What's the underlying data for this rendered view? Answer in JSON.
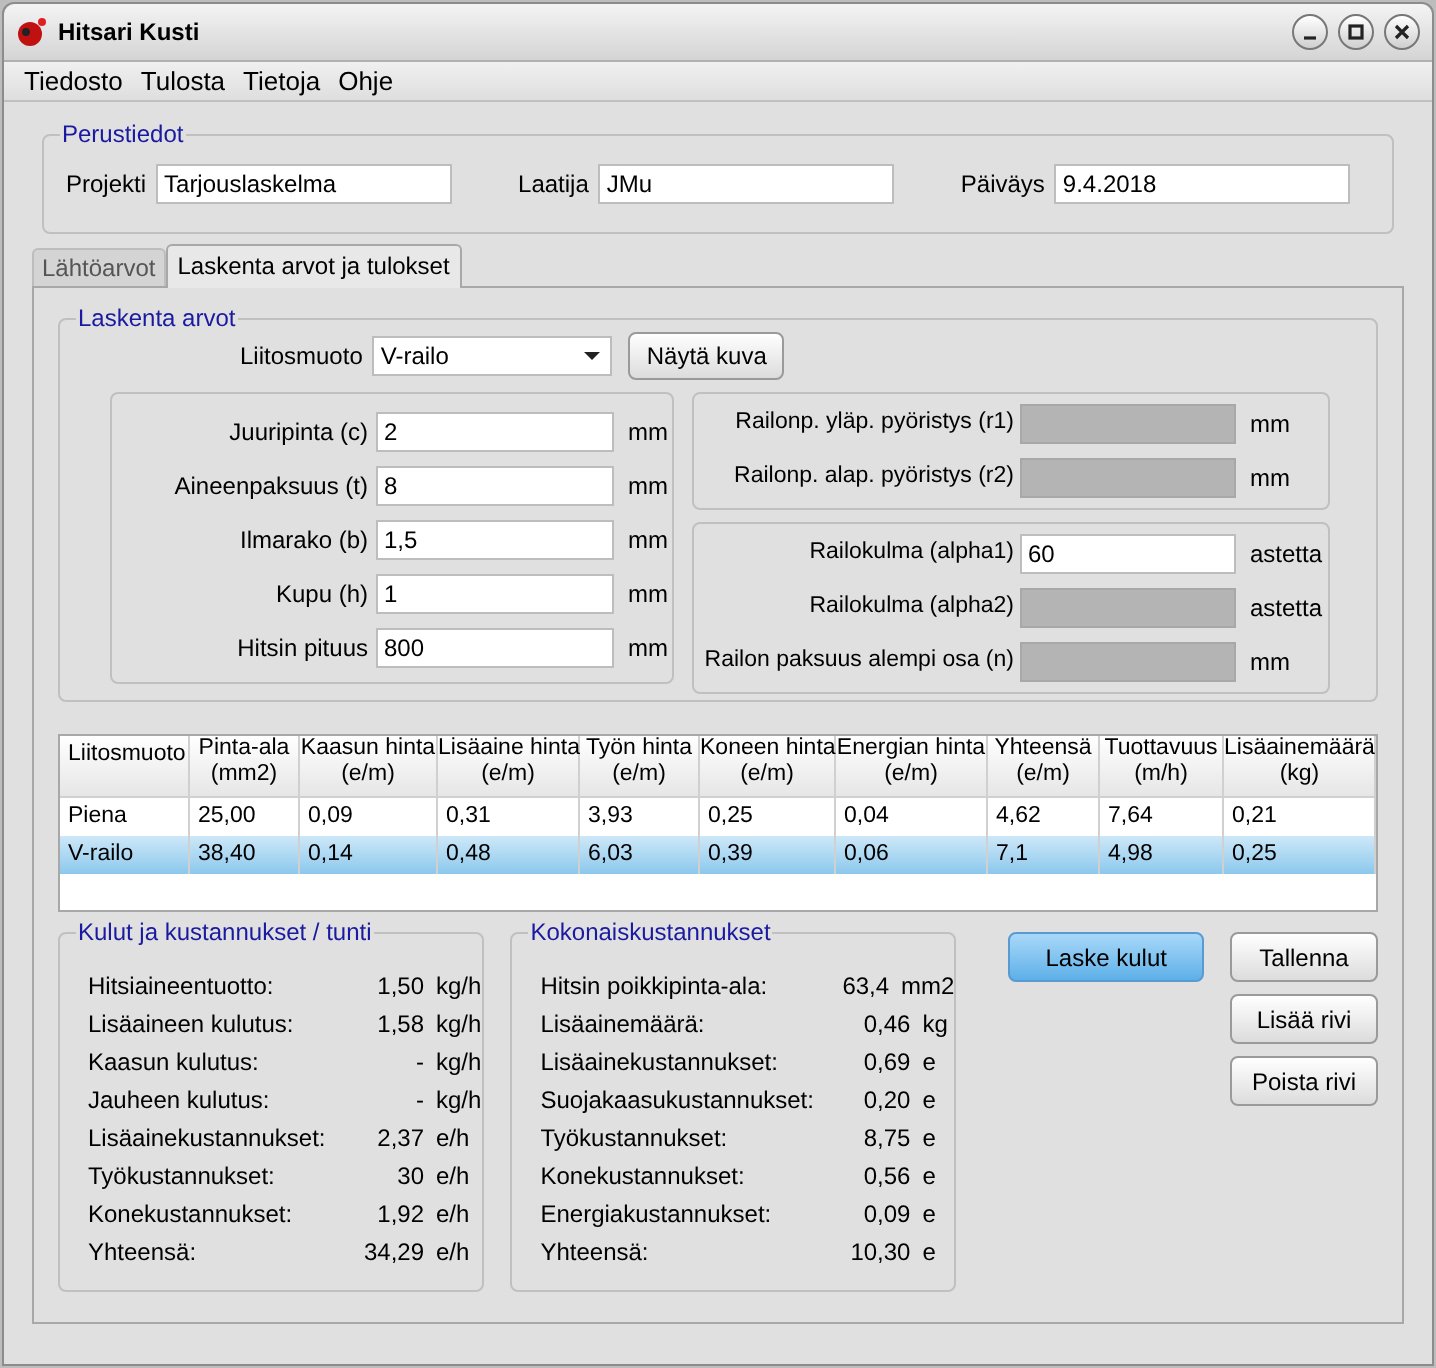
{
  "window": {
    "title": "Hitsari Kusti"
  },
  "menu": [
    "Tiedosto",
    "Tulosta",
    "Tietoja",
    "Ohje"
  ],
  "perustiedot": {
    "title": "Perustiedot",
    "fields": [
      {
        "label": "Projekti",
        "value": "Tarjouslaskelma"
      },
      {
        "label": "Laatija",
        "value": "JMu"
      },
      {
        "label": "Päiväys",
        "value": "9.4.2018"
      }
    ]
  },
  "tabs": [
    {
      "label": "Lähtöarvot",
      "selected": false
    },
    {
      "label": "Laskenta arvot ja tulokset",
      "selected": true
    }
  ],
  "laskenta": {
    "title": "Laskenta arvot",
    "liitosmuoto": {
      "label": "Liitosmuoto",
      "value": "V-railo"
    },
    "show_button": "Näytä kuva",
    "left_fields": [
      {
        "label": "Juuripinta (c)",
        "value": "2",
        "unit": "mm",
        "disabled": false
      },
      {
        "label": "Aineenpaksuus (t)",
        "value": "8",
        "unit": "mm",
        "disabled": false
      },
      {
        "label": "Ilmarako (b)",
        "value": "1,5",
        "unit": "mm",
        "disabled": false
      },
      {
        "label": "Kupu (h)",
        "value": "1",
        "unit": "mm",
        "disabled": false
      },
      {
        "label": "Hitsin pituus",
        "value": "800",
        "unit": "mm",
        "disabled": false
      }
    ],
    "right_groups": [
      [
        {
          "label": "Railonp. yläp. pyöristys (r1)",
          "unit": "mm",
          "disabled": true
        },
        {
          "label": "Railonp. alap. pyöristys (r2)",
          "unit": "mm",
          "disabled": true
        }
      ],
      [
        {
          "label": "Railokulma (alpha1)",
          "value": "60",
          "unit": "astetta",
          "disabled": false
        },
        {
          "label": "Railokulma (alpha2)",
          "unit": "astetta",
          "disabled": true
        },
        {
          "label": "Railon paksuus alempi osa (n)",
          "unit": "mm",
          "disabled": true
        }
      ]
    ]
  },
  "table": {
    "columns": [
      {
        "title": "Liitosmuoto"
      },
      {
        "title": "Pinta-ala",
        "unit": "(mm2)"
      },
      {
        "title": "Kaasun hinta",
        "unit": "(e/m)"
      },
      {
        "title": "Lisäaine hinta",
        "unit": "(e/m)"
      },
      {
        "title": "Työn hinta",
        "unit": "(e/m)"
      },
      {
        "title": "Koneen hinta",
        "unit": "(e/m)"
      },
      {
        "title": "Energian hinta",
        "unit": "(e/m)"
      },
      {
        "title": "Yhteensä",
        "unit": "(e/m)"
      },
      {
        "title": "Tuottavuus",
        "unit": "(m/h)"
      },
      {
        "title": "Lisäainemäärä",
        "unit": "(kg)"
      }
    ],
    "rows": [
      {
        "selected": false,
        "cells": [
          "Piena",
          "25,00",
          "0,09",
          "0,31",
          "3,93",
          "0,25",
          "0,04",
          "4,62",
          "7,64",
          "0,21"
        ]
      },
      {
        "selected": true,
        "cells": [
          "V-railo",
          "38,40",
          "0,14",
          "0,48",
          "6,03",
          "0,39",
          "0,06",
          "7,1",
          "4,98",
          "0,25"
        ]
      }
    ]
  },
  "costs_per_hour": {
    "title": "Kulut ja kustannukset / tunti",
    "rows": [
      {
        "label": "Hitsiaineentuotto:",
        "value": "1,50",
        "unit": "kg/h"
      },
      {
        "label": "Lisäaineen kulutus:",
        "value": "1,58",
        "unit": "kg/h"
      },
      {
        "label": "Kaasun kulutus:",
        "value": "-",
        "unit": "kg/h"
      },
      {
        "label": "Jauheen kulutus:",
        "value": "-",
        "unit": "kg/h"
      },
      {
        "label": "Lisäainekustannukset:",
        "value": "2,37",
        "unit": "e/h"
      },
      {
        "label": "Työkustannukset:",
        "value": "30",
        "unit": "e/h"
      },
      {
        "label": "Konekustannukset:",
        "value": "1,92",
        "unit": "e/h"
      },
      {
        "label": "Yhteensä:",
        "value": "34,29",
        "unit": "e/h"
      }
    ]
  },
  "total_costs": {
    "title": "Kokonaiskustannukset",
    "rows": [
      {
        "label": "Hitsin poikkipinta-ala:",
        "value": "63,4",
        "unit": "mm2"
      },
      {
        "label": "Lisäainemäärä:",
        "value": "0,46",
        "unit": "kg"
      },
      {
        "label": "Lisäainekustannukset:",
        "value": "0,69",
        "unit": "e"
      },
      {
        "label": "Suojakaasukustannukset:",
        "value": "0,20",
        "unit": "e"
      },
      {
        "label": "Työkustannukset:",
        "value": "8,75",
        "unit": "e"
      },
      {
        "label": "Konekustannukset:",
        "value": "0,56",
        "unit": "e"
      },
      {
        "label": "Energiakustannukset:",
        "value": "0,09",
        "unit": "e"
      },
      {
        "label": "Yhteensä:",
        "value": "10,30",
        "unit": "e"
      }
    ]
  },
  "buttons": {
    "primary": {
      "label": "Laske kulut"
    },
    "side": [
      {
        "label": "Tallenna"
      },
      {
        "label": "Lisää rivi"
      },
      {
        "label": "Poista rivi"
      }
    ]
  }
}
